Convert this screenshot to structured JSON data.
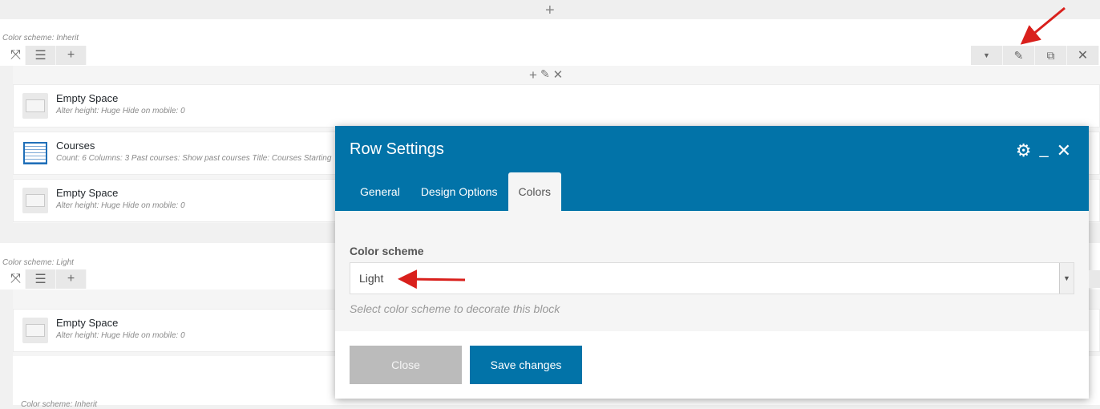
{
  "rows": [
    {
      "scheme_label": "Color scheme: Inherit",
      "elements": [
        {
          "title": "Empty Space",
          "subtitle": "Alter height: Huge  Hide on mobile: 0",
          "icon": "empty-space-icon"
        },
        {
          "title": "Courses",
          "subtitle": "Count: 6  Columns: 3  Past courses: Show past courses  Title: Courses Starting",
          "icon": "courses-list-icon"
        },
        {
          "title": "Empty Space",
          "subtitle": "Alter height: Huge  Hide on mobile: 0",
          "icon": "empty-space-icon"
        }
      ]
    },
    {
      "scheme_label": "Color scheme: Light",
      "elements": [
        {
          "title": "Empty Space",
          "subtitle": "Alter height: Huge  Hide on mobile: 0",
          "icon": "empty-space-icon"
        }
      ]
    }
  ],
  "bottom_partial_label": "Color scheme: Inherit",
  "modal": {
    "title": "Row Settings",
    "tabs": [
      "General",
      "Design Options",
      "Colors"
    ],
    "active_tab": "Colors",
    "field_label": "Color scheme",
    "selected_value": "Light",
    "help_text": "Select color scheme to decorate this block",
    "close_label": "Close",
    "save_label": "Save changes"
  },
  "colors": {
    "accent": "#0273a8",
    "annotation_arrow": "#d9201c"
  }
}
